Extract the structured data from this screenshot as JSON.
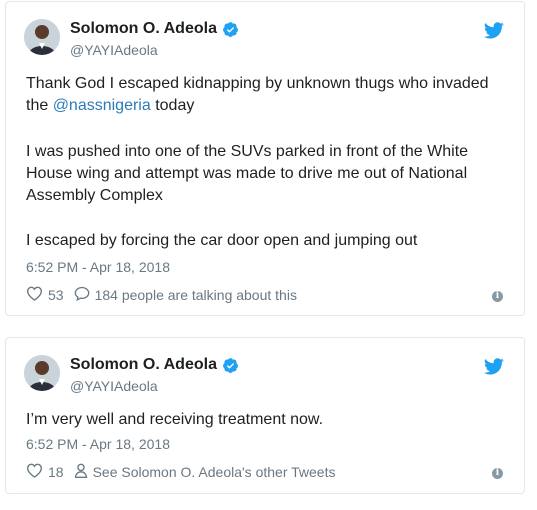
{
  "tweets": [
    {
      "author_name": "Solomon O. Adeola",
      "handle": "@YAYIAdeola",
      "text_line1": "Thank God I escaped kidnapping by unknown thugs who invaded",
      "text_line2_pre": "the ",
      "mention": "@nassnigeria",
      "text_line2_post": " today",
      "para2": "I was pushed into one of the SUVs parked in front of the White House wing and attempt was made to drive me out of National Assembly Complex",
      "para3": "I escaped by forcing the car door open and jumping out",
      "timestamp": "6:52 PM - Apr 18, 2018",
      "likes": "53",
      "conversation": "184 people are talking about this"
    },
    {
      "author_name": "Solomon O. Adeola",
      "handle": "@YAYIAdeola",
      "text": "I’m very well and receiving treatment now.",
      "timestamp": "6:52 PM - Apr 18, 2018",
      "likes": "18",
      "other_tweets": "See Solomon O. Adeola's other Tweets"
    }
  ],
  "icons": {
    "verified": "verified-badge-icon",
    "bird": "twitter-bird-icon",
    "like": "heart-icon",
    "reply": "speech-bubble-icon",
    "profile": "person-icon",
    "info": "info-icon"
  },
  "colors": {
    "twitter_blue": "#1da1f2",
    "link": "#2b7bb9",
    "muted": "#697882",
    "border": "#e1e8ed"
  }
}
